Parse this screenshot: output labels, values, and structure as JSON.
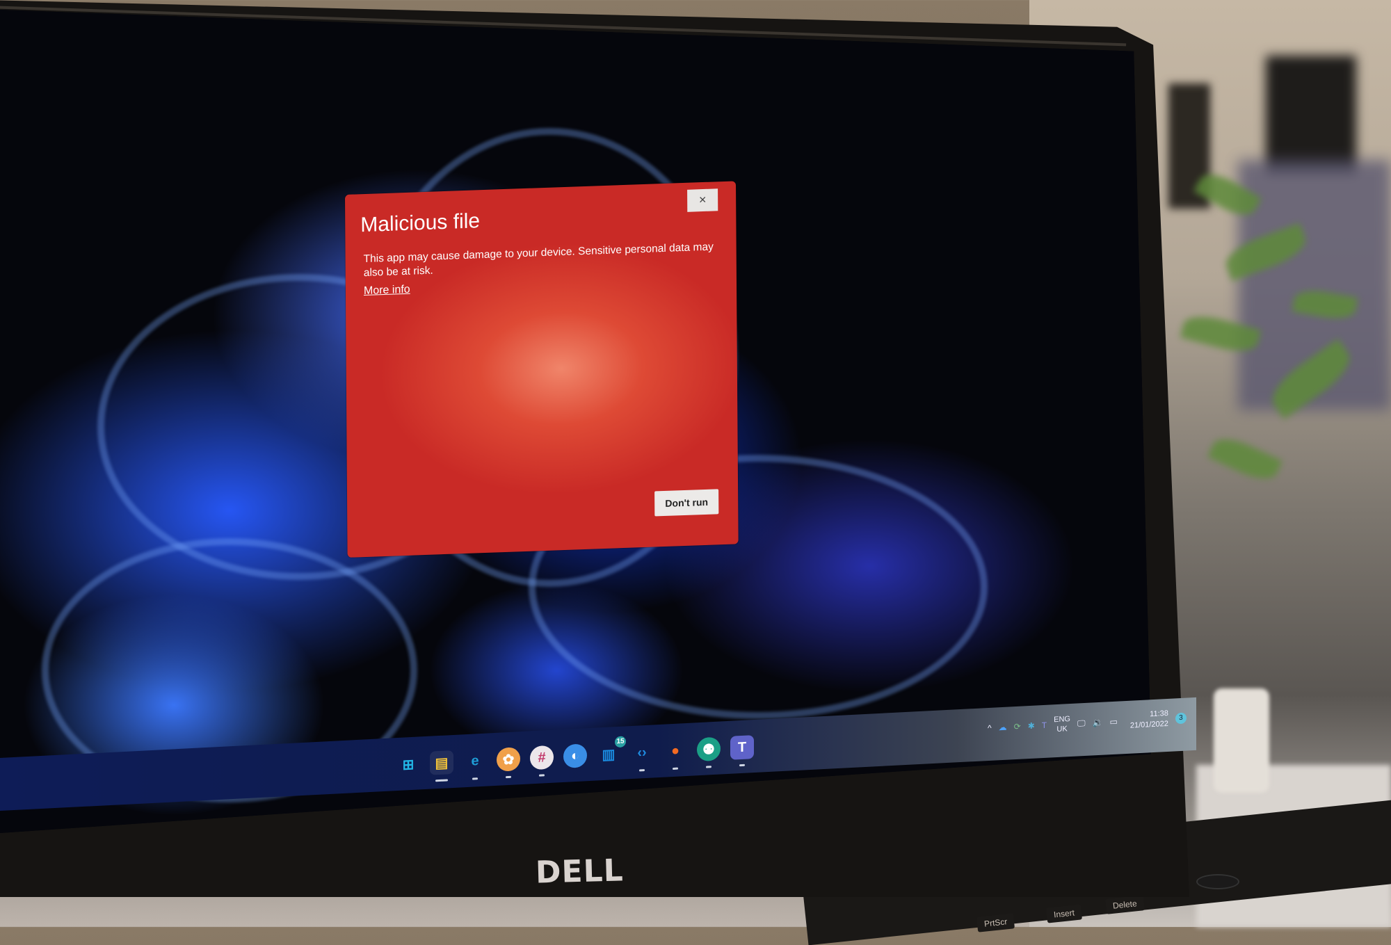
{
  "dialog": {
    "title": "Malicious file",
    "message": "This app may cause damage to your device. Sensitive personal data may also be at risk.",
    "link_label": "More info",
    "close_label": "×",
    "primary_button_label": "Don't run",
    "background_color": "#c92a26"
  },
  "taskbar": {
    "apps": [
      {
        "name": "start",
        "glyph": "⊞",
        "color": "#22b7e6"
      },
      {
        "name": "file-explorer",
        "glyph": "▤",
        "color": "#f2c33a"
      },
      {
        "name": "edge",
        "glyph": "e",
        "color": "#1f9ed6"
      },
      {
        "name": "app-orange",
        "glyph": "✿",
        "color": "#f0a04a"
      },
      {
        "name": "slack",
        "glyph": "#",
        "color": "#e8e3ea"
      },
      {
        "name": "app-blue-circle",
        "glyph": "◐",
        "color": "#3a8ee6"
      },
      {
        "name": "planner",
        "glyph": "▥",
        "color": "#1a8be0",
        "badge": "15"
      },
      {
        "name": "vscode",
        "glyph": "‹›",
        "color": "#1f8ce0"
      },
      {
        "name": "firefox",
        "glyph": "●",
        "color": "#f36b22"
      },
      {
        "name": "gitkraken",
        "glyph": "⚉",
        "color": "#1b9f86"
      },
      {
        "name": "teams",
        "glyph": "T",
        "color": "#5f63c9"
      }
    ],
    "tray": {
      "chevron": "^",
      "icons": [
        "onedrive",
        "sync",
        "slack-tray",
        "teams-tray"
      ],
      "language_line1": "ENG",
      "language_line2": "UK",
      "system_icons": [
        "network",
        "volume",
        "battery"
      ],
      "time": "11:38",
      "date": "21/01/2022",
      "notification_count": "3"
    }
  },
  "hardware": {
    "brand": "DELL",
    "keys": [
      "PrtScr",
      "Insert",
      "Delete"
    ]
  }
}
